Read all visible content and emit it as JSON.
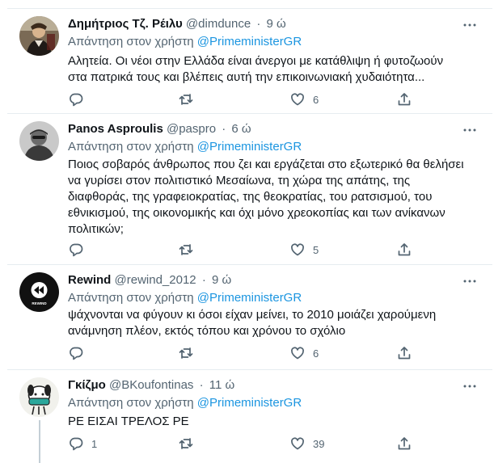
{
  "reply_prefix": "Απάντηση στον χρήστη",
  "tweets": [
    {
      "name": "Δημήτριος Τζ. Ρέιλυ",
      "handle": "@dimdunce",
      "time": "9 ώ",
      "reply_to": "@PrimeministerGR",
      "text": "Αλητεία. Οι νέοι στην Ελλάδα είναι άνεργοι με κατάθλιψη ή φυτοζωούν\nστα πατρικά τους και βλέπεις αυτή την επικοινωνιακή χυδαιότητα...",
      "replies": "",
      "retweets": "",
      "likes": "6"
    },
    {
      "name": "Panos Asproulis",
      "handle": "@paspro",
      "time": "6 ώ",
      "reply_to": "@PrimeministerGR",
      "text": "Ποιος σοβαρός άνθρωπος που ζει και εργάζεται στο εξωτερικό θα θελήσει\nνα γυρίσει στον πολιτιστικό Μεσαίωνα, τη χώρα της απάτης, της\nδιαφθοράς, της γραφειοκρατίας, της θεοκρατίας, του ρατσισμού, του\nεθνικισμού, της οικονομικής και όχι μόνο χρεοκοπίας και των ανίκανων\nπολιτικών;",
      "replies": "",
      "retweets": "",
      "likes": "5"
    },
    {
      "name": "Rewind",
      "handle": "@rewind_2012",
      "time": "9 ώ",
      "reply_to": "@PrimeministerGR",
      "avatar_label": "REWIND",
      "text": "ψάχνονται να φύγουν κι όσοι είχαν μείνει, το 2010 μοιάζει χαρούμενη\nανάμνηση πλέον, εκτός τόπου και χρόνου το σχόλιο",
      "replies": "",
      "retweets": "",
      "likes": "6"
    },
    {
      "name": "Γκίζμο",
      "handle": "@BKoufontinas",
      "time": "11 ώ",
      "reply_to": "@PrimeministerGR",
      "text": "ΡΕ ΕΙΣΑΙ ΤΡΕΛΟΣ ΡΕ",
      "replies": "1",
      "retweets": "",
      "likes": "39"
    }
  ],
  "icons": {
    "reply": "reply-icon",
    "retweet": "retweet-icon",
    "like": "heart-icon",
    "share": "share-icon",
    "more": "more-dots-icon"
  },
  "colors": {
    "mention": "#1b95e0",
    "secondary_text": "#536471",
    "divider": "#e6ecf0",
    "thread_line": "#c4cfd6"
  }
}
